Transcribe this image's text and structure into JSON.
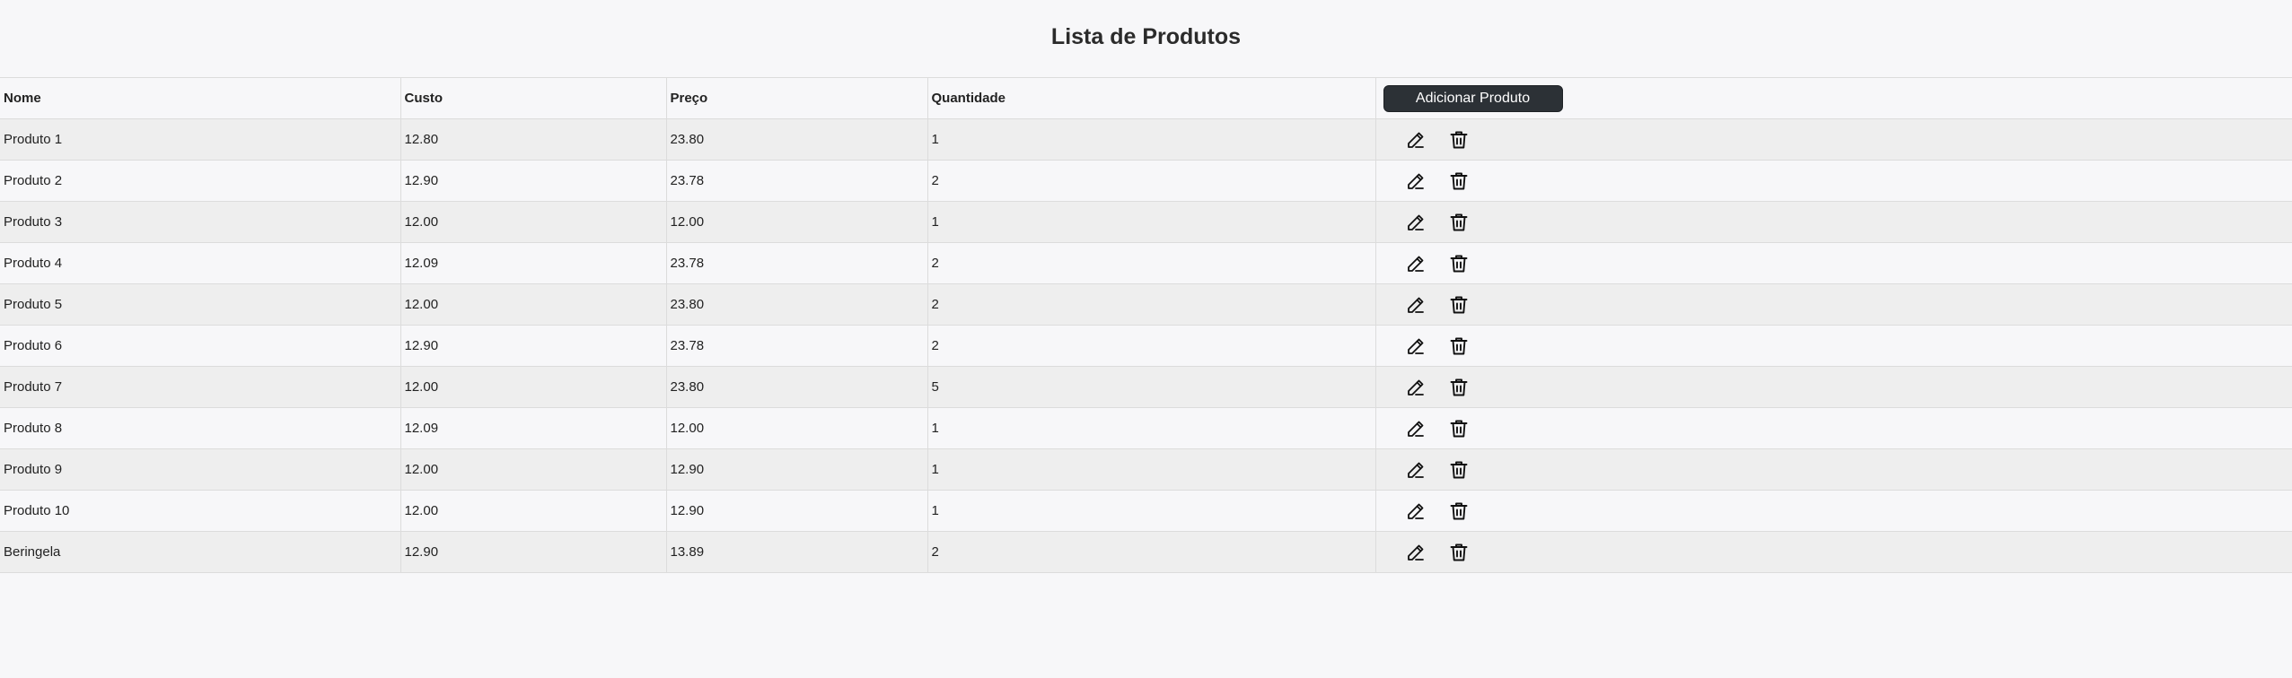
{
  "page": {
    "title": "Lista de Produtos"
  },
  "table": {
    "columns": [
      "Nome",
      "Custo",
      "Preço",
      "Quantidade"
    ],
    "add_button_label": "Adicionar Produto",
    "rows": [
      {
        "nome": "Produto 1",
        "custo": "12.80",
        "preco": "23.80",
        "quantidade": "1"
      },
      {
        "nome": "Produto 2",
        "custo": "12.90",
        "preco": "23.78",
        "quantidade": "2"
      },
      {
        "nome": "Produto 3",
        "custo": "12.00",
        "preco": "12.00",
        "quantidade": "1"
      },
      {
        "nome": "Produto 4",
        "custo": "12.09",
        "preco": "23.78",
        "quantidade": "2"
      },
      {
        "nome": "Produto 5",
        "custo": "12.00",
        "preco": "23.80",
        "quantidade": "2"
      },
      {
        "nome": "Produto 6",
        "custo": "12.90",
        "preco": "23.78",
        "quantidade": "2"
      },
      {
        "nome": "Produto 7",
        "custo": "12.00",
        "preco": "23.80",
        "quantidade": "5"
      },
      {
        "nome": "Produto 8",
        "custo": "12.09",
        "preco": "12.00",
        "quantidade": "1"
      },
      {
        "nome": "Produto 9",
        "custo": "12.00",
        "preco": "12.90",
        "quantidade": "1"
      },
      {
        "nome": "Produto 10",
        "custo": "12.00",
        "preco": "12.90",
        "quantidade": "1"
      },
      {
        "nome": "Beringela",
        "custo": "12.90",
        "preco": "13.89",
        "quantidade": "2"
      }
    ],
    "row_actions": [
      {
        "icon": "pencil-icon",
        "action": "edit"
      },
      {
        "icon": "trash-icon",
        "action": "delete"
      }
    ]
  },
  "colors": {
    "background": "#f7f7f9",
    "row_alt": "#eeeeee",
    "border": "#dcdcdc",
    "button_bg": "#2c3136",
    "button_text": "#ffffff"
  }
}
